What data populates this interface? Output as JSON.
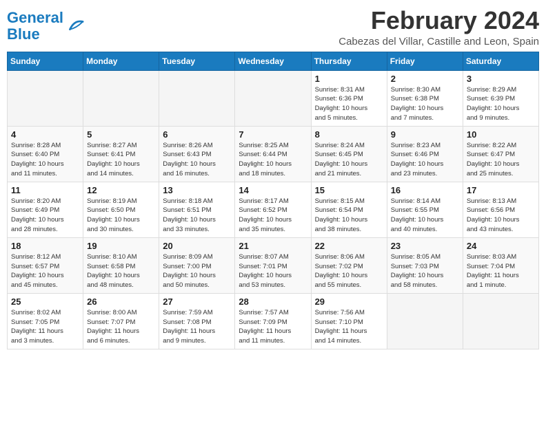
{
  "header": {
    "logo_general": "General",
    "logo_blue": "Blue",
    "month_year": "February 2024",
    "location": "Cabezas del Villar, Castille and Leon, Spain"
  },
  "weekdays": [
    "Sunday",
    "Monday",
    "Tuesday",
    "Wednesday",
    "Thursday",
    "Friday",
    "Saturday"
  ],
  "weeks": [
    [
      {
        "day": "",
        "info": ""
      },
      {
        "day": "",
        "info": ""
      },
      {
        "day": "",
        "info": ""
      },
      {
        "day": "",
        "info": ""
      },
      {
        "day": "1",
        "info": "Sunrise: 8:31 AM\nSunset: 6:36 PM\nDaylight: 10 hours\nand 5 minutes."
      },
      {
        "day": "2",
        "info": "Sunrise: 8:30 AM\nSunset: 6:38 PM\nDaylight: 10 hours\nand 7 minutes."
      },
      {
        "day": "3",
        "info": "Sunrise: 8:29 AM\nSunset: 6:39 PM\nDaylight: 10 hours\nand 9 minutes."
      }
    ],
    [
      {
        "day": "4",
        "info": "Sunrise: 8:28 AM\nSunset: 6:40 PM\nDaylight: 10 hours\nand 11 minutes."
      },
      {
        "day": "5",
        "info": "Sunrise: 8:27 AM\nSunset: 6:41 PM\nDaylight: 10 hours\nand 14 minutes."
      },
      {
        "day": "6",
        "info": "Sunrise: 8:26 AM\nSunset: 6:43 PM\nDaylight: 10 hours\nand 16 minutes."
      },
      {
        "day": "7",
        "info": "Sunrise: 8:25 AM\nSunset: 6:44 PM\nDaylight: 10 hours\nand 18 minutes."
      },
      {
        "day": "8",
        "info": "Sunrise: 8:24 AM\nSunset: 6:45 PM\nDaylight: 10 hours\nand 21 minutes."
      },
      {
        "day": "9",
        "info": "Sunrise: 8:23 AM\nSunset: 6:46 PM\nDaylight: 10 hours\nand 23 minutes."
      },
      {
        "day": "10",
        "info": "Sunrise: 8:22 AM\nSunset: 6:47 PM\nDaylight: 10 hours\nand 25 minutes."
      }
    ],
    [
      {
        "day": "11",
        "info": "Sunrise: 8:20 AM\nSunset: 6:49 PM\nDaylight: 10 hours\nand 28 minutes."
      },
      {
        "day": "12",
        "info": "Sunrise: 8:19 AM\nSunset: 6:50 PM\nDaylight: 10 hours\nand 30 minutes."
      },
      {
        "day": "13",
        "info": "Sunrise: 8:18 AM\nSunset: 6:51 PM\nDaylight: 10 hours\nand 33 minutes."
      },
      {
        "day": "14",
        "info": "Sunrise: 8:17 AM\nSunset: 6:52 PM\nDaylight: 10 hours\nand 35 minutes."
      },
      {
        "day": "15",
        "info": "Sunrise: 8:15 AM\nSunset: 6:54 PM\nDaylight: 10 hours\nand 38 minutes."
      },
      {
        "day": "16",
        "info": "Sunrise: 8:14 AM\nSunset: 6:55 PM\nDaylight: 10 hours\nand 40 minutes."
      },
      {
        "day": "17",
        "info": "Sunrise: 8:13 AM\nSunset: 6:56 PM\nDaylight: 10 hours\nand 43 minutes."
      }
    ],
    [
      {
        "day": "18",
        "info": "Sunrise: 8:12 AM\nSunset: 6:57 PM\nDaylight: 10 hours\nand 45 minutes."
      },
      {
        "day": "19",
        "info": "Sunrise: 8:10 AM\nSunset: 6:58 PM\nDaylight: 10 hours\nand 48 minutes."
      },
      {
        "day": "20",
        "info": "Sunrise: 8:09 AM\nSunset: 7:00 PM\nDaylight: 10 hours\nand 50 minutes."
      },
      {
        "day": "21",
        "info": "Sunrise: 8:07 AM\nSunset: 7:01 PM\nDaylight: 10 hours\nand 53 minutes."
      },
      {
        "day": "22",
        "info": "Sunrise: 8:06 AM\nSunset: 7:02 PM\nDaylight: 10 hours\nand 55 minutes."
      },
      {
        "day": "23",
        "info": "Sunrise: 8:05 AM\nSunset: 7:03 PM\nDaylight: 10 hours\nand 58 minutes."
      },
      {
        "day": "24",
        "info": "Sunrise: 8:03 AM\nSunset: 7:04 PM\nDaylight: 11 hours\nand 1 minute."
      }
    ],
    [
      {
        "day": "25",
        "info": "Sunrise: 8:02 AM\nSunset: 7:05 PM\nDaylight: 11 hours\nand 3 minutes."
      },
      {
        "day": "26",
        "info": "Sunrise: 8:00 AM\nSunset: 7:07 PM\nDaylight: 11 hours\nand 6 minutes."
      },
      {
        "day": "27",
        "info": "Sunrise: 7:59 AM\nSunset: 7:08 PM\nDaylight: 11 hours\nand 9 minutes."
      },
      {
        "day": "28",
        "info": "Sunrise: 7:57 AM\nSunset: 7:09 PM\nDaylight: 11 hours\nand 11 minutes."
      },
      {
        "day": "29",
        "info": "Sunrise: 7:56 AM\nSunset: 7:10 PM\nDaylight: 11 hours\nand 14 minutes."
      },
      {
        "day": "",
        "info": ""
      },
      {
        "day": "",
        "info": ""
      }
    ]
  ]
}
